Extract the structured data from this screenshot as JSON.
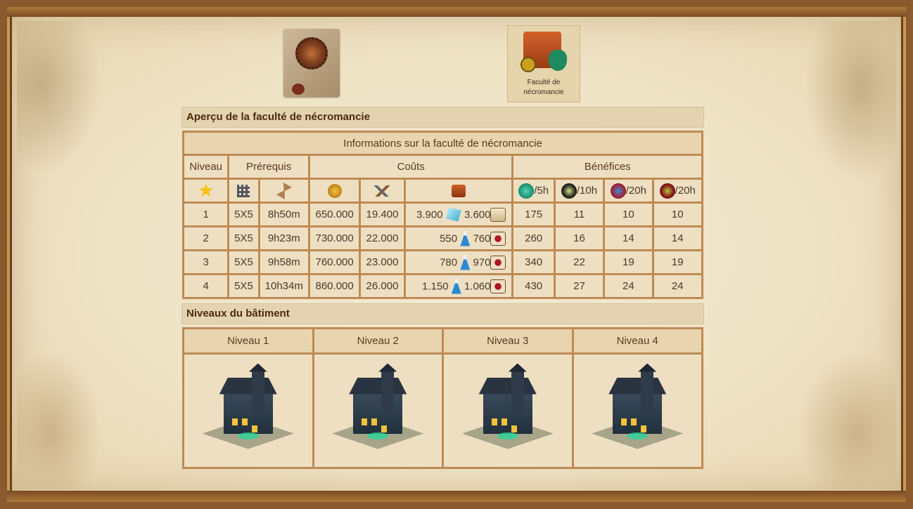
{
  "top": {
    "building_card_label": "Faculté de nécromancie"
  },
  "overview": {
    "section_title": "Aperçu de la faculté de nécromancie",
    "table_title": "Informations sur la faculté de nécromancie",
    "headers": {
      "level": "Niveau",
      "prereq": "Prérequis",
      "costs": "Coûts",
      "benefits": "Bénéfices"
    },
    "benefit_periods": [
      "/5h",
      "/10h",
      "/20h",
      "/20h"
    ],
    "rows": [
      {
        "level": "1",
        "size": "5X5",
        "time": "8h50m",
        "coins": "650.000",
        "supplies": "19.400",
        "res1": "3.900",
        "res2": "3.600"
      },
      {
        "level": "2",
        "size": "5X5",
        "time": "9h23m",
        "coins": "730.000",
        "supplies": "22.000",
        "res1": "550",
        "res2": "760"
      },
      {
        "level": "3",
        "size": "5X5",
        "time": "9h58m",
        "coins": "760.000",
        "supplies": "23.000",
        "res1": "780",
        "res2": "970"
      },
      {
        "level": "4",
        "size": "5X5",
        "time": "10h34m",
        "coins": "860.000",
        "supplies": "26.000",
        "res1": "1.150",
        "res2": "1.060"
      }
    ],
    "benefits": [
      [
        "175",
        "11",
        "10",
        "10"
      ],
      [
        "260",
        "16",
        "14",
        "14"
      ],
      [
        "340",
        "22",
        "19",
        "19"
      ],
      [
        "430",
        "27",
        "24",
        "24"
      ]
    ]
  },
  "levels": {
    "section_title": "Niveaux du bâtiment",
    "labels": [
      "Niveau 1",
      "Niveau 2",
      "Niveau 3",
      "Niveau 4"
    ]
  },
  "icons": {
    "prereq": [
      "star-icon",
      "grid-icon",
      "hourglass-icon"
    ],
    "costs": [
      "coin-icon",
      "tools-icon",
      "resource-box-icon"
    ],
    "benefits": [
      "ghost-icon",
      "skull-icon",
      "potion-icon",
      "spider-icon"
    ]
  }
}
